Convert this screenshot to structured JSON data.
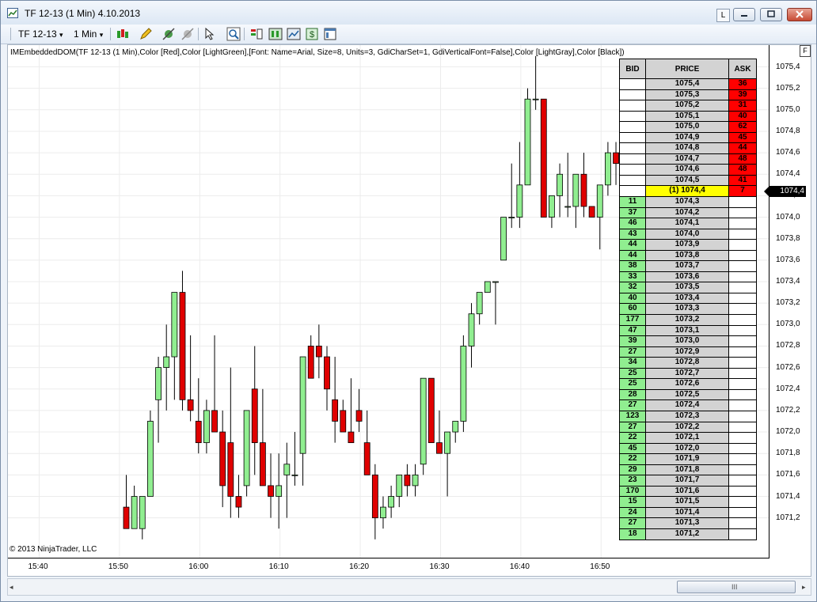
{
  "window": {
    "title": "TF 12-13 (1 Min)  4.10.2013",
    "layout_button": "L"
  },
  "toolbar": {
    "instrument": "TF 12-13",
    "interval": "1 Min",
    "dropdown_glyph": "▾"
  },
  "chart": {
    "indicator_label": "IMEmbeddedDOM(TF 12-13 (1 Min),Color [Red],Color [LightGreen],[Font: Name=Arial, Size=8, Units=3, GdiCharSet=1, GdiVerticalFont=False],Color [LightGray],Color [Black])",
    "copyright": "© 2013 NinjaTrader, LLC",
    "panel_button": "F",
    "up_color": "#90ee90",
    "down_color": "#e00000",
    "last_price_label": "1074,4",
    "price_axis": {
      "min": 1071.0,
      "max": 1075.5,
      "labels": [
        "1075,4",
        "1075,2",
        "1075,0",
        "1074,8",
        "1074,6",
        "1074,4",
        "1074,2",
        "1074,0",
        "1073,8",
        "1073,6",
        "1073,4",
        "1073,2",
        "1073,0",
        "1072,8",
        "1072,6",
        "1072,4",
        "1072,2",
        "1072,0",
        "1071,8",
        "1071,6",
        "1071,4",
        "1071,2"
      ]
    },
    "time_axis": {
      "labels": [
        "15:40",
        "15:50",
        "16:00",
        "16:10",
        "16:20",
        "16:30",
        "16:40",
        "16:50"
      ]
    }
  },
  "chart_data": {
    "type": "candlestick",
    "x_start": "15:51",
    "interval_minutes": 1,
    "ohlc": [
      [
        1071.3,
        1071.6,
        1071.1,
        1071.1
      ],
      [
        1071.1,
        1071.5,
        1071.1,
        1071.4
      ],
      [
        1071.1,
        1071.4,
        1071.0,
        1071.4
      ],
      [
        1071.4,
        1072.2,
        1071.4,
        1072.1
      ],
      [
        1072.3,
        1072.7,
        1071.9,
        1072.6
      ],
      [
        1072.6,
        1073.0,
        1072.2,
        1072.7
      ],
      [
        1072.7,
        1073.3,
        1072.3,
        1073.3
      ],
      [
        1073.3,
        1073.5,
        1072.2,
        1072.3
      ],
      [
        1072.3,
        1072.9,
        1072.1,
        1072.2
      ],
      [
        1072.1,
        1072.5,
        1071.8,
        1071.9
      ],
      [
        1071.9,
        1072.3,
        1071.8,
        1072.2
      ],
      [
        1072.2,
        1072.9,
        1072.0,
        1072.0
      ],
      [
        1072.0,
        1072.2,
        1071.3,
        1071.5
      ],
      [
        1071.9,
        1072.6,
        1071.2,
        1071.4
      ],
      [
        1071.4,
        1071.6,
        1071.2,
        1071.3
      ],
      [
        1071.5,
        1072.2,
        1071.4,
        1072.2
      ],
      [
        1072.4,
        1072.8,
        1071.6,
        1071.9
      ],
      [
        1071.9,
        1072.4,
        1071.6,
        1071.5
      ],
      [
        1071.5,
        1071.8,
        1071.2,
        1071.4
      ],
      [
        1071.4,
        1071.8,
        1071.1,
        1071.5
      ],
      [
        1071.6,
        1071.9,
        1071.2,
        1071.7
      ],
      [
        1071.6,
        1072.0,
        1071.5,
        1071.6
      ],
      [
        1071.8,
        1072.7,
        1071.5,
        1072.7
      ],
      [
        1072.8,
        1072.9,
        1072.5,
        1072.5
      ],
      [
        1072.8,
        1073.0,
        1072.5,
        1072.7
      ],
      [
        1072.7,
        1072.8,
        1072.2,
        1072.4
      ],
      [
        1072.3,
        1072.7,
        1071.9,
        1072.1
      ],
      [
        1072.2,
        1072.3,
        1072.1,
        1072.0
      ],
      [
        1072.0,
        1072.5,
        1071.9,
        1071.9
      ],
      [
        1072.2,
        1072.4,
        1072.0,
        1072.1
      ],
      [
        1071.9,
        1072.2,
        1071.8,
        1071.6
      ],
      [
        1071.6,
        1071.7,
        1071.0,
        1071.2
      ],
      [
        1071.2,
        1071.4,
        1071.1,
        1071.3
      ],
      [
        1071.3,
        1071.5,
        1071.2,
        1071.4
      ],
      [
        1071.4,
        1071.6,
        1071.3,
        1071.6
      ],
      [
        1071.6,
        1071.7,
        1071.4,
        1071.5
      ],
      [
        1071.5,
        1071.7,
        1071.4,
        1071.6
      ],
      [
        1071.7,
        1072.5,
        1071.6,
        1072.5
      ],
      [
        1072.5,
        1072.4,
        1071.9,
        1071.9
      ],
      [
        1071.9,
        1072.2,
        1071.8,
        1071.8
      ],
      [
        1071.8,
        1072.0,
        1071.4,
        1072.0
      ],
      [
        1072.0,
        1072.1,
        1071.9,
        1072.1
      ],
      [
        1072.1,
        1072.9,
        1072.0,
        1072.8
      ],
      [
        1072.8,
        1073.2,
        1072.6,
        1073.1
      ],
      [
        1073.1,
        1073.3,
        1073.0,
        1073.3
      ],
      [
        1073.3,
        1073.4,
        1073.3,
        1073.4
      ],
      [
        1073.4,
        1073.4,
        1073.0,
        1073.4
      ],
      [
        1073.6,
        1074.0,
        1073.6,
        1074.0
      ],
      [
        1074.0,
        1074.5,
        1073.9,
        1074.0
      ],
      [
        1074.0,
        1074.7,
        1073.9,
        1074.3
      ],
      [
        1074.3,
        1075.2,
        1074.3,
        1075.1
      ],
      [
        1075.1,
        1075.5,
        1075.0,
        1075.1
      ],
      [
        1075.1,
        1075.0,
        1074.0,
        1074.0
      ],
      [
        1074.0,
        1074.2,
        1073.9,
        1074.2
      ],
      [
        1074.2,
        1074.5,
        1074.0,
        1074.4
      ],
      [
        1074.1,
        1074.6,
        1074.0,
        1074.1
      ],
      [
        1074.1,
        1074.4,
        1073.9,
        1074.4
      ],
      [
        1074.4,
        1074.6,
        1074.0,
        1074.1
      ],
      [
        1074.1,
        1074.1,
        1074.0,
        1074.0
      ],
      [
        1074.0,
        1074.3,
        1073.7,
        1074.3
      ],
      [
        1074.3,
        1074.7,
        1074.2,
        1074.6
      ],
      [
        1074.6,
        1074.7,
        1074.3,
        1074.5
      ],
      [
        1074.5,
        1074.6,
        1074.0,
        1074.0
      ],
      [
        1074.0,
        1074.6,
        1074.0,
        1074.6
      ],
      [
        1074.3,
        1074.4,
        1074.0,
        1074.0
      ],
      [
        1074.4,
        1074.8,
        1074.3,
        1074.7
      ],
      [
        1074.7,
        1074.7,
        1074.3,
        1074.4
      ]
    ]
  },
  "dom": {
    "headers": {
      "bid": "BID",
      "price": "PRICE",
      "ask": "ASK"
    },
    "bid_color": "#90ee90",
    "ask_color": "#ff0000",
    "current_color": "#ffff00",
    "rows": [
      {
        "price": "1075,4",
        "bid": "",
        "ask": "36"
      },
      {
        "price": "1075,3",
        "bid": "",
        "ask": "39"
      },
      {
        "price": "1075,2",
        "bid": "",
        "ask": "31"
      },
      {
        "price": "1075,1",
        "bid": "",
        "ask": "40"
      },
      {
        "price": "1075,0",
        "bid": "",
        "ask": "62"
      },
      {
        "price": "1074,9",
        "bid": "",
        "ask": "45"
      },
      {
        "price": "1074,8",
        "bid": "",
        "ask": "44"
      },
      {
        "price": "1074,7",
        "bid": "",
        "ask": "48"
      },
      {
        "price": "1074,6",
        "bid": "",
        "ask": "48"
      },
      {
        "price": "1074,5",
        "bid": "",
        "ask": "41"
      },
      {
        "price": "(1) 1074,4",
        "bid": "",
        "ask": "7",
        "current": true
      },
      {
        "price": "1074,3",
        "bid": "11",
        "ask": ""
      },
      {
        "price": "1074,2",
        "bid": "37",
        "ask": ""
      },
      {
        "price": "1074,1",
        "bid": "46",
        "ask": ""
      },
      {
        "price": "1074,0",
        "bid": "43",
        "ask": ""
      },
      {
        "price": "1073,9",
        "bid": "44",
        "ask": ""
      },
      {
        "price": "1073,8",
        "bid": "44",
        "ask": ""
      },
      {
        "price": "1073,7",
        "bid": "38",
        "ask": ""
      },
      {
        "price": "1073,6",
        "bid": "33",
        "ask": ""
      },
      {
        "price": "1073,5",
        "bid": "32",
        "ask": ""
      },
      {
        "price": "1073,4",
        "bid": "40",
        "ask": ""
      },
      {
        "price": "1073,3",
        "bid": "60",
        "ask": ""
      },
      {
        "price": "1073,2",
        "bid": "177",
        "ask": ""
      },
      {
        "price": "1073,1",
        "bid": "47",
        "ask": ""
      },
      {
        "price": "1073,0",
        "bid": "39",
        "ask": ""
      },
      {
        "price": "1072,9",
        "bid": "27",
        "ask": ""
      },
      {
        "price": "1072,8",
        "bid": "34",
        "ask": ""
      },
      {
        "price": "1072,7",
        "bid": "25",
        "ask": ""
      },
      {
        "price": "1072,6",
        "bid": "25",
        "ask": ""
      },
      {
        "price": "1072,5",
        "bid": "28",
        "ask": ""
      },
      {
        "price": "1072,4",
        "bid": "27",
        "ask": ""
      },
      {
        "price": "1072,3",
        "bid": "123",
        "ask": ""
      },
      {
        "price": "1072,2",
        "bid": "27",
        "ask": ""
      },
      {
        "price": "1072,1",
        "bid": "22",
        "ask": ""
      },
      {
        "price": "1072,0",
        "bid": "45",
        "ask": ""
      },
      {
        "price": "1071,9",
        "bid": "22",
        "ask": ""
      },
      {
        "price": "1071,8",
        "bid": "29",
        "ask": ""
      },
      {
        "price": "1071,7",
        "bid": "23",
        "ask": ""
      },
      {
        "price": "1071,6",
        "bid": "170",
        "ask": ""
      },
      {
        "price": "1071,5",
        "bid": "15",
        "ask": ""
      },
      {
        "price": "1071,4",
        "bid": "24",
        "ask": ""
      },
      {
        "price": "1071,3",
        "bid": "27",
        "ask": ""
      },
      {
        "price": "1071,2",
        "bid": "18",
        "ask": ""
      }
    ]
  },
  "scrollbar": {
    "grip": "III",
    "left_arrow": "◂",
    "right_arrow": "▸"
  }
}
